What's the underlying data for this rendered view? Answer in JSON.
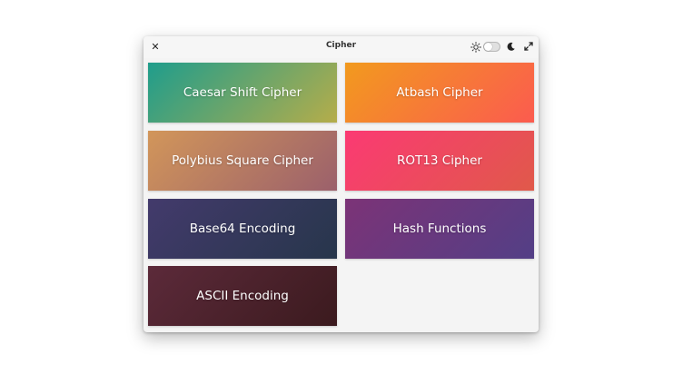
{
  "window": {
    "title": "Cipher"
  },
  "tiles": [
    {
      "label": "Caesar Shift Cipher",
      "gradient_from": "#1f9d8c",
      "gradient_to": "#b5ad4a"
    },
    {
      "label": "Atbash Cipher",
      "gradient_from": "#f29a1e",
      "gradient_to": "#fb5b4f"
    },
    {
      "label": "Polybius Square Cipher",
      "gradient_from": "#d2965a",
      "gradient_to": "#9b606b"
    },
    {
      "label": "ROT13 Cipher",
      "gradient_from": "#fb3a73",
      "gradient_to": "#e0594a"
    },
    {
      "label": "Base64 Encoding",
      "gradient_from": "#433a6c",
      "gradient_to": "#27364b"
    },
    {
      "label": "Hash Functions",
      "gradient_from": "#7c3377",
      "gradient_to": "#533f86"
    },
    {
      "label": "ASCII Encoding",
      "gradient_from": "#5c2a3a",
      "gradient_to": "#3b1a1e"
    }
  ]
}
